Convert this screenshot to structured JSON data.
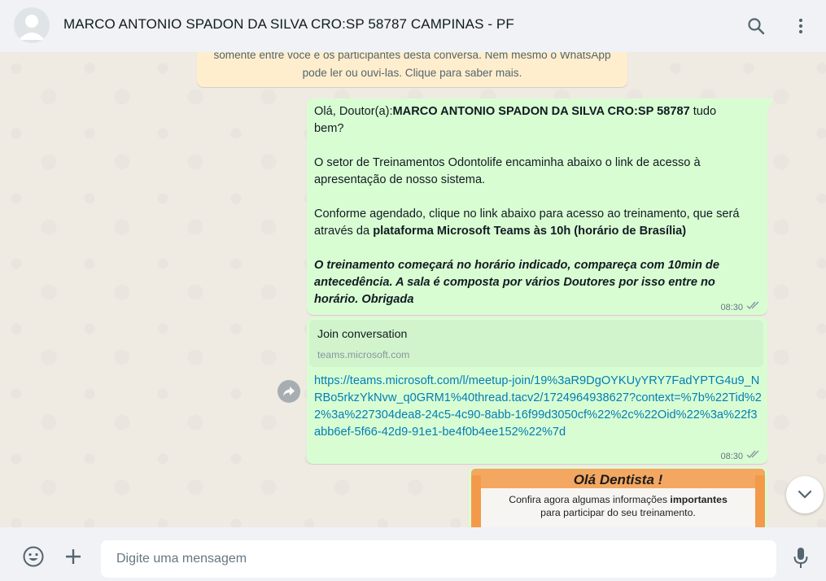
{
  "header": {
    "contact_name": "MARCO ANTONIO SPADON DA SILVA CRO:SP 58787 CAMPINAS - PF",
    "icons": [
      "search-icon",
      "menu-icon"
    ]
  },
  "notice": {
    "line1": "somente entre você e os participantes desta conversa. Nem mesmo o WhatsApp",
    "line2": "pode ler ou ouvi-las. Clique para saber mais."
  },
  "message1": {
    "greeting_prefix": "Olá, Doutor(a):",
    "doctor_name": "MARCO ANTONIO SPADON DA SILVA CRO:SP 58787",
    "greeting_suffix": " tudo bem?",
    "paragraph2": "O setor de Treinamentos Odontolife encaminha abaixo o link de acesso à apresentação de nosso sistema.",
    "paragraph3_prefix": "Conforme agendado, clique no link abaixo para acesso ao treinamento, que será através da ",
    "paragraph3_bold": "plataforma Microsoft Teams às 10h (horário de Brasília)",
    "paragraph4": "O treinamento começará no horário indicado, compareça com 10min de antecedência. A sala é composta por vários Doutores por isso entre no horário. Obrigada",
    "time": "08:30"
  },
  "message2": {
    "preview_title": "Join conversation",
    "preview_domain": "teams.microsoft.com",
    "link": "https://teams.microsoft.com/l/meetup-join/19%3aR9DgOYKUyYRY7FadYPTG4u9_NRBo5rkzYkNvw_q0GRM1%40thread.tacv2/1724964938627?context=%7b%22Tid%22%3a%227304dea8-24c5-4c90-8abb-16f99d3050cf%22%2c%22Oid%22%3a%22f3abb6ef-5f66-42d9-91e1-be4f0b4ee152%22%7d",
    "time": "08:30"
  },
  "message3": {
    "image_title": "Olá Dentista !",
    "image_sub_prefix": "Confira agora algumas informações ",
    "image_sub_bold": "importantes",
    "image_sub_line2": "para participar do seu treinamento."
  },
  "composer": {
    "placeholder": "Digite uma mensagem"
  },
  "colors": {
    "bubble_out": "#d9fdd3",
    "link": "#027eb5",
    "notice_bg": "#ffeecd"
  }
}
